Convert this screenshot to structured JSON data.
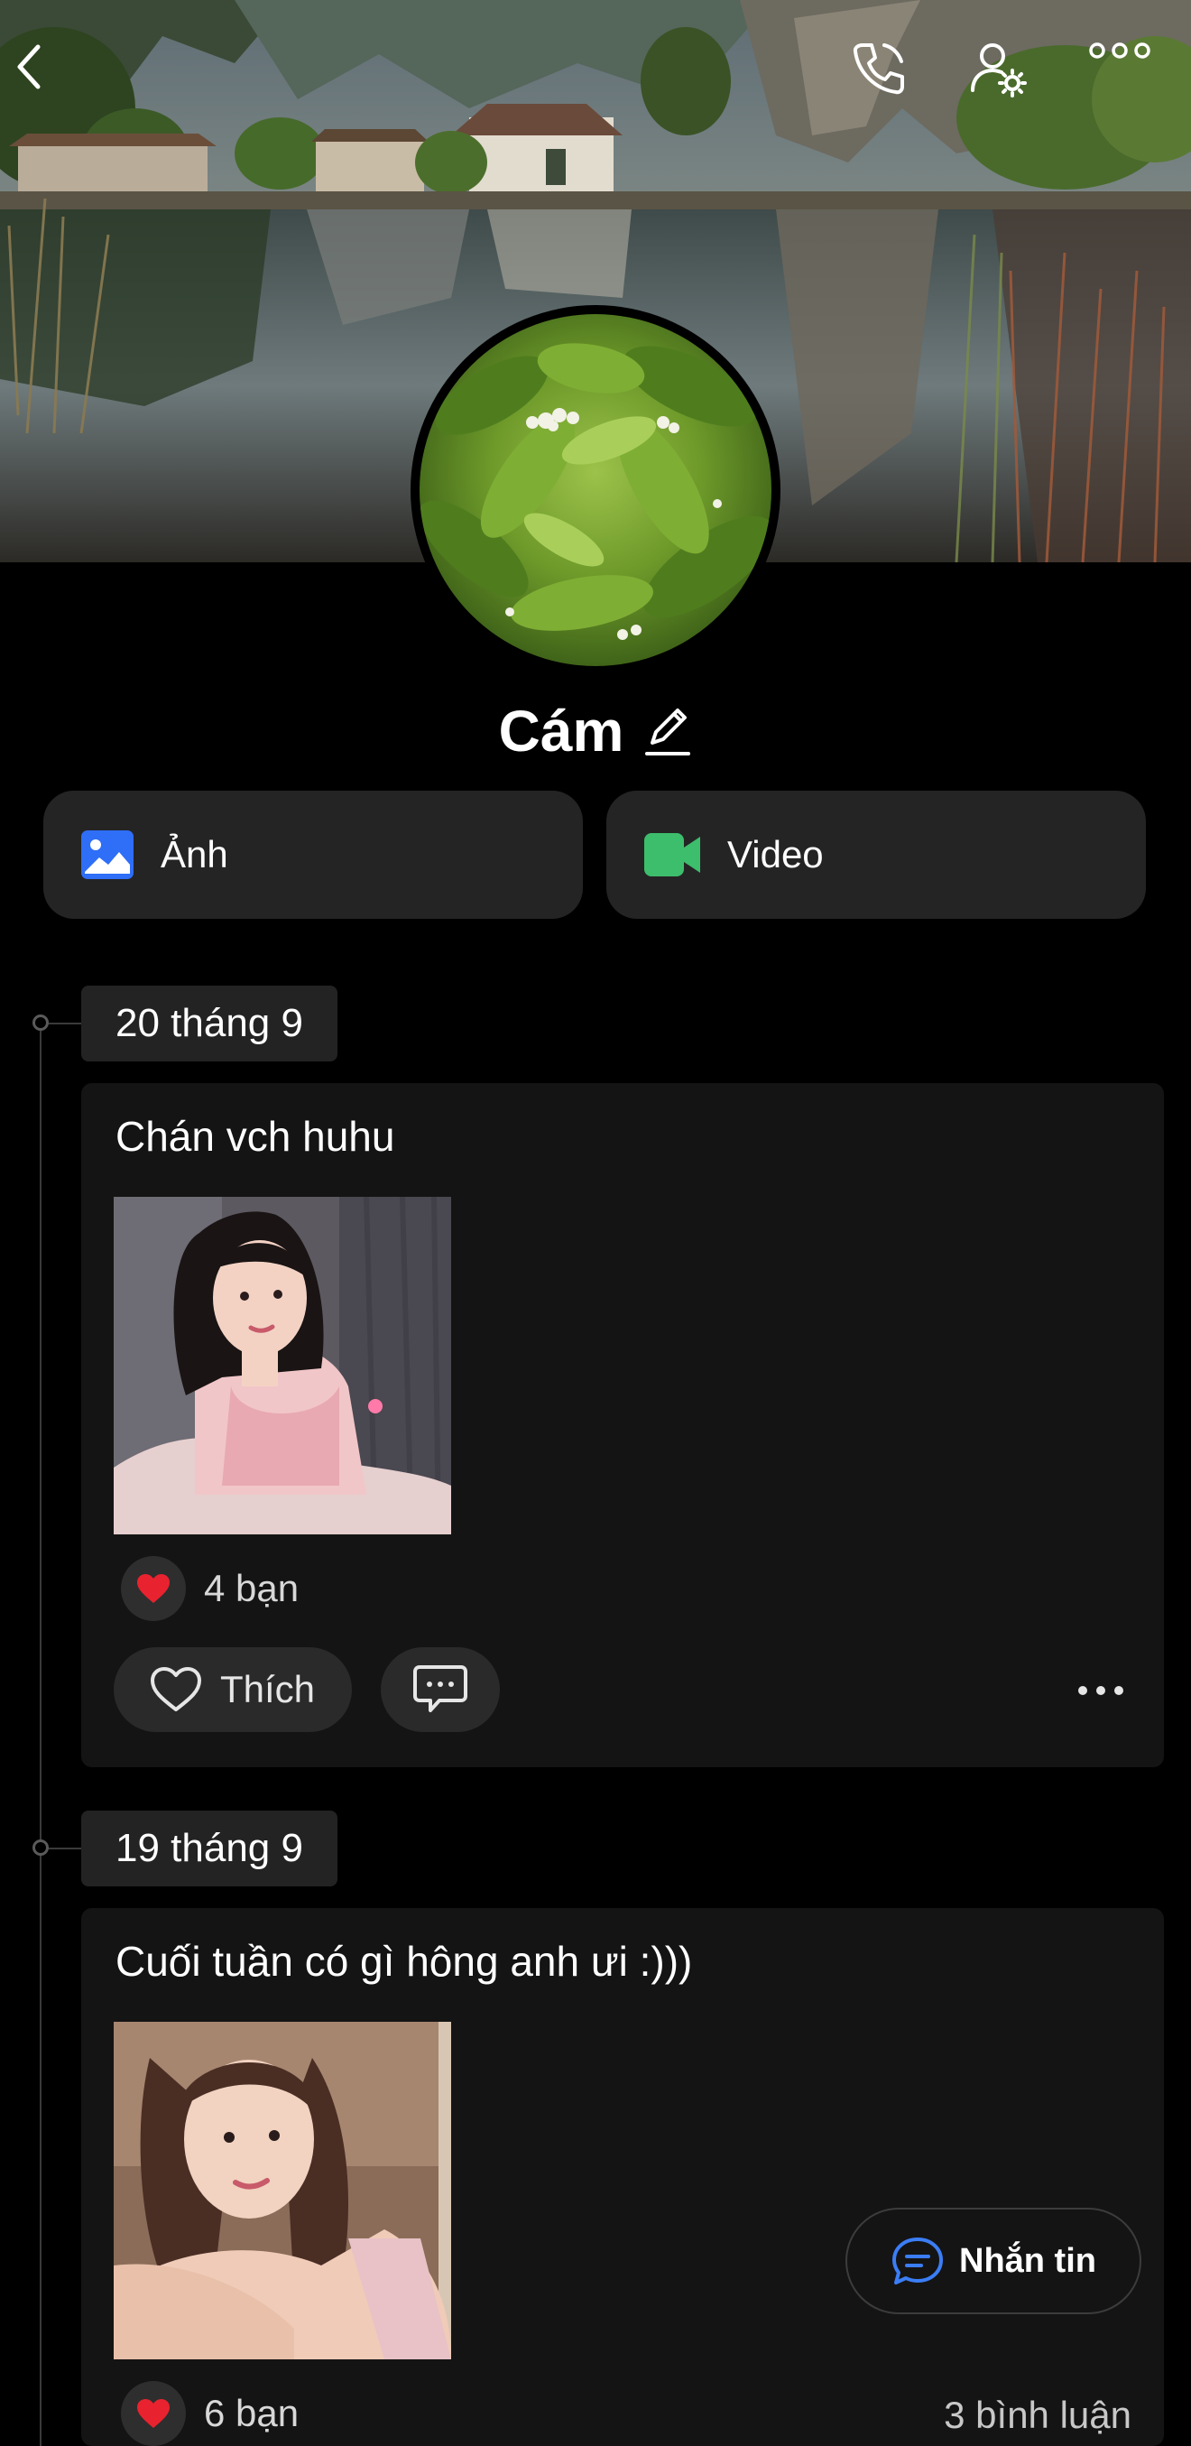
{
  "header": {
    "back_icon": "chevron-left-icon",
    "call_icon": "phone-icon",
    "profile_settings_icon": "user-settings-icon",
    "more_icon": "more-horizontal-icon"
  },
  "profile": {
    "name": "Cám",
    "edit_icon": "pencil-icon"
  },
  "media_buttons": {
    "photo_label": "Ảnh",
    "video_label": "Video",
    "photo_color": "#2f6ef6",
    "video_color": "#3dbe6c"
  },
  "posts": [
    {
      "date": "20 tháng 9",
      "text": "Chán vch huhu",
      "reaction_count": "4 bạn",
      "comment_count": "",
      "like_label": "Thích"
    },
    {
      "date": "19 tháng 9",
      "text": "Cuối tuần có gì hông anh ưi :)))",
      "reaction_count": "6 bạn",
      "comment_count": "3 bình luận",
      "like_label": ""
    }
  ],
  "floating": {
    "message_label": "Nhắn tin",
    "accent": "#3b7df5"
  }
}
